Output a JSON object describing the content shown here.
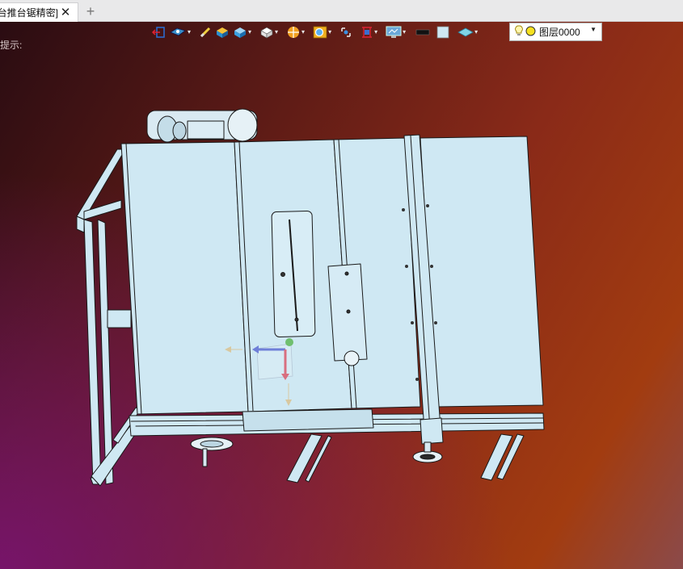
{
  "tab": {
    "title": "[台推台锯精密]"
  },
  "viewport": {
    "hint_text": "提示:"
  },
  "toolbar": {
    "buttons": [
      "exit-sketch-icon",
      "view-orient-icon",
      "measure-icon",
      "shaded-box-icon",
      "render-mode-icon",
      "cube-view-icon",
      "section-view-icon",
      "zoom-fit-icon",
      "snap-icon",
      "frame-icon",
      "display-monitor-icon",
      "line-color-swatch",
      "fill-color-swatch",
      "surface-style-icon"
    ],
    "layer_label": "图层0000"
  },
  "colors": {
    "part_fill": "#cfe8f3",
    "part_stroke": "#1a1a1a",
    "axis_x": "#6f7fd8",
    "axis_y": "#d86f7f",
    "axis_z": "#6fbf6f"
  }
}
